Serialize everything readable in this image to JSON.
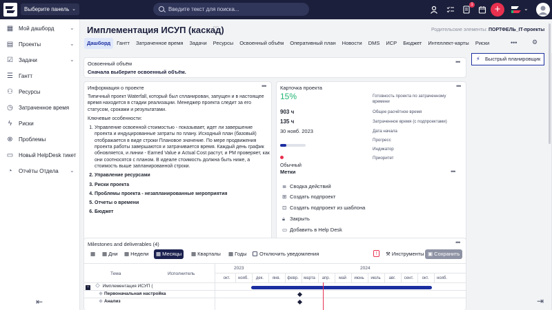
{
  "topbar": {
    "panel_select": "Выберите панель",
    "search_placeholder": "Введите текст для поиска...",
    "notif_count": "1",
    "icons": [
      "user-icon",
      "tasks-icon",
      "notifications-icon",
      "calendar-icon",
      "add-icon",
      "apps-icon"
    ]
  },
  "sidebar": {
    "items": [
      {
        "label": "Мой дашборд",
        "icon": "dashboard-icon",
        "chevron": true
      },
      {
        "label": "Проекты",
        "icon": "projects-icon",
        "chevron": true
      },
      {
        "label": "Задачи",
        "icon": "tasks-icon",
        "chevron": true
      },
      {
        "label": "Гантт",
        "icon": "gantt-icon",
        "chevron": false
      },
      {
        "label": "Ресурсы",
        "icon": "resources-icon",
        "chevron": false
      },
      {
        "label": "Затраченное время",
        "icon": "clock-icon",
        "chevron": false
      },
      {
        "label": "Риски",
        "icon": "risks-icon",
        "chevron": false
      },
      {
        "label": "Проблемы",
        "icon": "problems-icon",
        "chevron": false
      },
      {
        "label": "Новый HelpDesk тикет",
        "icon": "ticket-icon",
        "chevron": false
      },
      {
        "label": "Отчёты Отдела",
        "icon": "reports-icon",
        "chevron": true
      }
    ]
  },
  "page": {
    "title": "Имплементация ИСУП (каскад)",
    "parent_label": "Родительские элементы:",
    "parent_value": "ПОРТФЕЛЬ_IT-проекты"
  },
  "tabs": [
    "Дашборд",
    "Гантт",
    "Затраченное время",
    "Задачи",
    "Ресурсы",
    "Освоенный объём",
    "Оперативный план",
    "Новости",
    "DMS",
    "ИСР",
    "Бюджет",
    "Интеллект-карты",
    "Риски"
  ],
  "earned_value": {
    "title": "Освоенный объём",
    "message": "Сначала выберите освоенный объём."
  },
  "info": {
    "title": "Информация о проекте",
    "description": "Типичный проект Waterfall, который был спланирован, запущен и в настоящее время находится в стадии реализации. Менеджер проекта следит за его статусом, сроками и результатами.",
    "features_title": "Ключевые особенности:",
    "features": [
      "Управление освоенной стоимостью - показывает, идет ли завершение проекта и индуцированные затраты по плану. Исходный план (базовый) отображается в виде строки Плановое значение. По мере продвижения проекта работы завершаются и затрачивается время. Каждый день график обновляется, и линии - Earned Value и Actual Cost растут, и PM проверяет, как они соотносятся с планом. В идеале стоимость должна быть ниже, а стоимость выше запланированной строки.",
      "Управление ресурсами",
      "Риски проекта",
      "Проблемы проекта - незапланированные мероприятия",
      "Отчеты о времени",
      "Бюджет"
    ]
  },
  "project_card": {
    "title": "Карточка проекта",
    "percent": "15%",
    "percent_label": "Готовность проекта по затраченному времени",
    "estimated": "903 ч",
    "estimated_label": "Общее расчётное время",
    "spent": "135 ч",
    "spent_label": "Затраченное время (с подпроектами)",
    "start_date": "30 нояб. 2023",
    "start_label": "Дата начала",
    "progress": 0.25,
    "progress_label": "Прогресс",
    "indicator_label": "Индикатор",
    "priority": "Обычный",
    "priority_label": "Приоритет",
    "labels_title": "Метки",
    "actions": [
      {
        "label": "Сводка действий",
        "icon": "list-icon"
      },
      {
        "label": "Создать подпроект",
        "icon": "plus-square-icon"
      },
      {
        "label": "Создать подпроект из шаблона",
        "icon": "template-icon"
      },
      {
        "label": "Закрыть",
        "icon": "lock-icon"
      },
      {
        "label": "Добавить в Help Desk",
        "icon": "helpdesk-icon"
      }
    ]
  },
  "quick_planner": "Быстрый планировщик",
  "milestones": {
    "title": "Milestones and deliverables (4)",
    "buttons": [
      "Дни",
      "Недели",
      "Месяцы",
      "Кварталы",
      "Годы"
    ],
    "notifications": "Отключить уведомления",
    "tools": "Инструменты",
    "save": "Сохранить",
    "col_topic": "Тема",
    "col_assignee": "Исполнитель",
    "years": [
      "2023",
      "2024"
    ],
    "months": [
      "окт.",
      "нояб.",
      "дек.",
      "янв.",
      "февр.",
      "марта",
      "апр.",
      "май",
      "июнь",
      "июль",
      "авг.",
      "сент.",
      "окт.",
      "нояб."
    ],
    "rows": [
      "Имплементация ИСУП (",
      "Первоначальная настройка",
      "Анализ"
    ]
  }
}
